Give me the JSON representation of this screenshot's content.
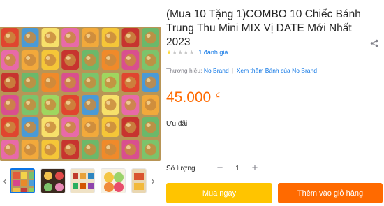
{
  "product": {
    "title": "(Mua 10 Tặng 1)COMBO 10 Chiếc Bánh Trung Thu Mini MIX Vị DATE Mới Nhất 2023",
    "rating": 1,
    "rating_max": 5,
    "rating_count_text": "1 đánh giá",
    "brand_label": "Thương hiệu:",
    "brand_name": "No Brand",
    "brand_more": "Xem thêm Bánh của No Brand",
    "price": "45.000",
    "currency": "₫",
    "promo_label": "Ưu đãi"
  },
  "quantity": {
    "label": "Số lượng",
    "value": "1",
    "minus": "−",
    "plus": "+"
  },
  "actions": {
    "buy_now": "Mua ngay",
    "add_to_cart": "Thêm vào giỏ hàng"
  },
  "icons": {
    "share": "share-icon",
    "prev": "chevron-left-icon",
    "next": "chevron-right-icon"
  },
  "colors": {
    "price": "#ff6a00",
    "link": "#0b74e5",
    "buy_button": "#ffc400",
    "cart_button": "#ff6a00",
    "star_on": "#fdd836"
  }
}
